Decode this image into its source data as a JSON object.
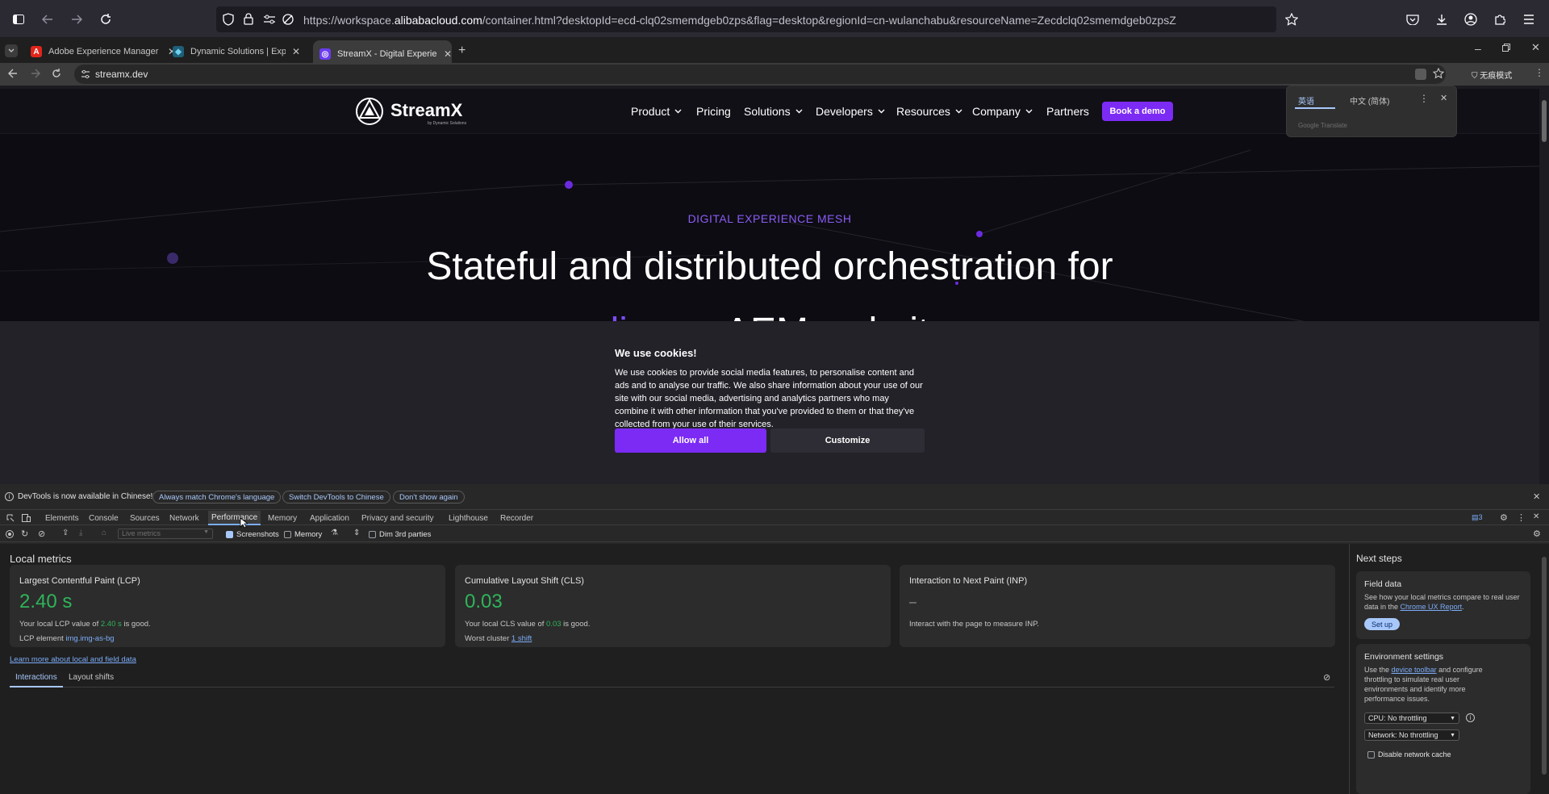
{
  "firefox": {
    "url_prefix": "https://workspace.",
    "url_domain": "alibabacloud.com",
    "url_suffix": "/container.html?desktopId=ecd-clq02smemdgeb0zps&flag=desktop&regionId=cn-wulanchabu&resourceName=Zecdclq02smemdgeb0zpsZ"
  },
  "tabs": [
    {
      "title": "Adobe Experience Manager",
      "icon": "adobe-icon",
      "color": "#e1251b",
      "glyph": "A"
    },
    {
      "title": "Dynamic Solutions | Experience",
      "icon": "dynamic-solutions-icon",
      "color": "#4fb3d9",
      "glyph": "◆"
    },
    {
      "title": "StreamX - Digital Experience",
      "icon": "streamx-icon",
      "color": "#6b3cf0",
      "glyph": "◎"
    }
  ],
  "omnibox": {
    "url": "streamx.dev",
    "profile_label": "无痕模式"
  },
  "site": {
    "logo_text": "StreamX",
    "logo_sub": "by Dynamic Solutions",
    "nav": [
      "Product",
      "Pricing",
      "Solutions",
      "Developers",
      "Resources",
      "Company",
      "Partners"
    ],
    "book_demo": "Book a demo",
    "eyebrow": "DIGITAL EXPERIENCE MESH",
    "title": "Stateful and distributed orchestration for",
    "title2_a": "li",
    "title2_b": "AEM websit",
    "cookie": {
      "title": "We use cookies!",
      "body": "We use cookies to provide social media features, to personalise content and ads and to analyse our traffic. We also share information about your use of our site with our social media, advertising and analytics partners who may combine it with other information that you've provided to them or that they've collected from your use of their services.",
      "allow": "Allow all",
      "customize": "Customize"
    }
  },
  "translate": {
    "lang1": "英语",
    "lang2": "中文 (简体)",
    "brand": "Google Translate"
  },
  "devtools": {
    "info_text": "DevTools is now available in Chinese!",
    "info_btn1": "Always match Chrome's language",
    "info_btn2": "Switch DevTools to Chinese",
    "info_btn3": "Don't show again",
    "tabs": [
      "Elements",
      "Console",
      "Sources",
      "Network",
      "Performance",
      "Memory",
      "Application",
      "Privacy and security",
      "Lighthouse",
      "Recorder"
    ],
    "issues_count": "3",
    "toolbar": {
      "select_placeholder": "Live metrics",
      "screenshots": "Screenshots",
      "memory": "Memory",
      "dim": "Dim 3rd parties"
    },
    "local_metrics": "Local metrics",
    "lcp": {
      "title": "Largest Contentful Paint (LCP)",
      "value": "2.40 s",
      "desc_a": "Your local LCP value of ",
      "desc_val": "2.40 s",
      "desc_b": " is good.",
      "elem_label": "LCP element",
      "elem_val": "img.img-as-bg"
    },
    "cls": {
      "title": "Cumulative Layout Shift (CLS)",
      "value": "0.03",
      "desc_a": "Your local CLS value of ",
      "desc_val": "0.03",
      "desc_b": " is good.",
      "worst_label": "Worst cluster",
      "worst_val": "1 shift"
    },
    "inp": {
      "title": "Interaction to Next Paint (INP)",
      "value": "–",
      "desc": "Interact with the page to measure INP."
    },
    "learn_more": "Learn more about local and field data",
    "subtabs": [
      "Interactions",
      "Layout shifts"
    ],
    "next_steps": "Next steps",
    "field_data": {
      "title": "Field data",
      "desc_a": "See how your local metrics compare to real user data in the ",
      "link": "Chrome UX Report",
      "desc_b": ".",
      "button": "Set up"
    },
    "env": {
      "title": "Environment settings",
      "desc_a": "Use the ",
      "link": "device toolbar",
      "desc_b": " and configure throttling to simulate real user environments and identify more performance issues.",
      "cpu": "CPU: No throttling",
      "network": "Network: No throttling",
      "disable_cache": "Disable network cache"
    }
  }
}
